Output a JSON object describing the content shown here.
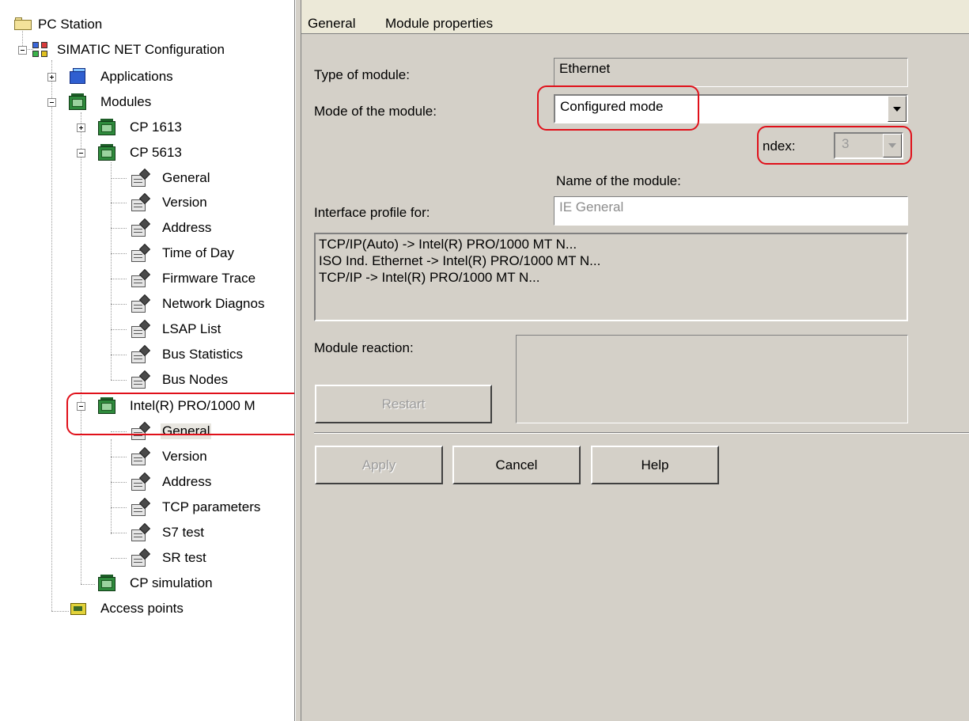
{
  "tree": {
    "root": "PC Station",
    "config": "SIMATIC NET Configuration",
    "applications": "Applications",
    "modules": "Modules",
    "cp1613": "CP 1613",
    "cp5613": "CP 5613",
    "cp5613_children": [
      "General",
      "Version",
      "Address",
      "Time of Day",
      "Firmware Trace",
      "Network Diagnos",
      "LSAP List",
      "Bus Statistics",
      "Bus Nodes"
    ],
    "intel": "Intel(R) PRO/1000 M",
    "intel_children": [
      "General",
      "Version",
      "Address",
      "TCP parameters",
      "S7 test",
      "SR test"
    ],
    "cp_simulation": "CP simulation",
    "access_points": "Access points"
  },
  "props": {
    "tab_general": "General",
    "tab_module_properties": "Module properties",
    "type_label": "Type of module:",
    "type_value": "Ethernet",
    "mode_label": "Mode of the module:",
    "mode_value": "Configured mode",
    "index_label": "ndex:",
    "index_value": "3",
    "name_label": "Name of the module:",
    "profile_label": "Interface profile for:",
    "profile_value": "IE General",
    "interfaces": [
      "TCP/IP(Auto) -> Intel(R) PRO/1000 MT N...",
      "ISO Ind. Ethernet -> Intel(R) PRO/1000 MT N...",
      "TCP/IP -> Intel(R) PRO/1000 MT N..."
    ],
    "reaction_label": "Module reaction:",
    "restart": "Restart",
    "apply": "Apply",
    "cancel": "Cancel",
    "help": "Help"
  },
  "highlight_color": "#e0101a"
}
